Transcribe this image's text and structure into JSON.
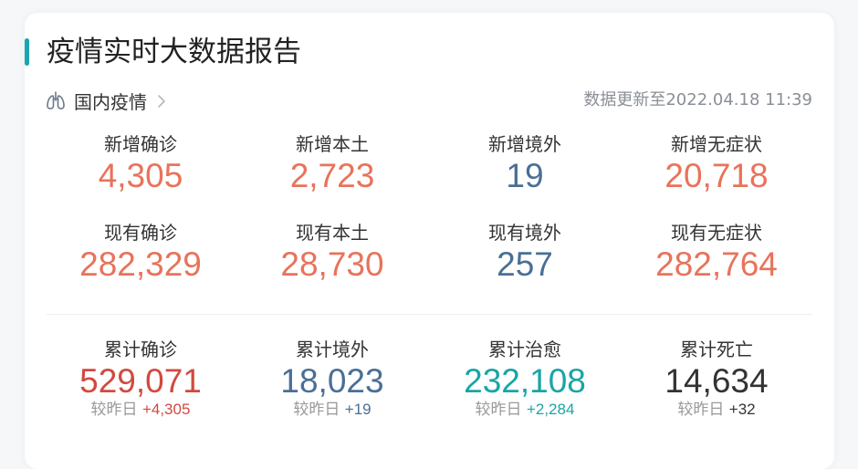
{
  "card": {
    "title": "疫情实时大数据报告",
    "section_label": "国内疫情",
    "update_text": "数据更新至2022.04.18 11:39"
  },
  "stats_row1": [
    {
      "label": "新增确诊",
      "value": "4,305",
      "color": "#e8735b"
    },
    {
      "label": "新增本土",
      "value": "2,723",
      "color": "#e8735b"
    },
    {
      "label": "新增境外",
      "value": "19",
      "color": "#4a6f96"
    },
    {
      "label": "新增无症状",
      "value": "20,718",
      "color": "#e8735b"
    }
  ],
  "stats_row2": [
    {
      "label": "现有确诊",
      "value": "282,329",
      "color": "#e8735b"
    },
    {
      "label": "现有本土",
      "value": "28,730",
      "color": "#e8735b"
    },
    {
      "label": "现有境外",
      "value": "257",
      "color": "#4a6f96"
    },
    {
      "label": "现有无症状",
      "value": "282,764",
      "color": "#e8735b"
    }
  ],
  "stats_row3": [
    {
      "label": "累计确诊",
      "value": "529,071",
      "delta_prefix": "较昨日",
      "delta": "+4,305",
      "color": "#d24a3f"
    },
    {
      "label": "累计境外",
      "value": "18,023",
      "delta_prefix": "较昨日",
      "delta": "+19",
      "color": "#4a6f96"
    },
    {
      "label": "累计治愈",
      "value": "232,108",
      "delta_prefix": "较昨日",
      "delta": "+2,284",
      "color": "#1aa5a5"
    },
    {
      "label": "累计死亡",
      "value": "14,634",
      "delta_prefix": "较昨日",
      "delta": "+32",
      "color": "#333333"
    }
  ],
  "colors": {
    "accent_bar": "#1aa5b1"
  },
  "icons": {
    "section": "lungs-icon",
    "more": "chevron-right-icon"
  }
}
